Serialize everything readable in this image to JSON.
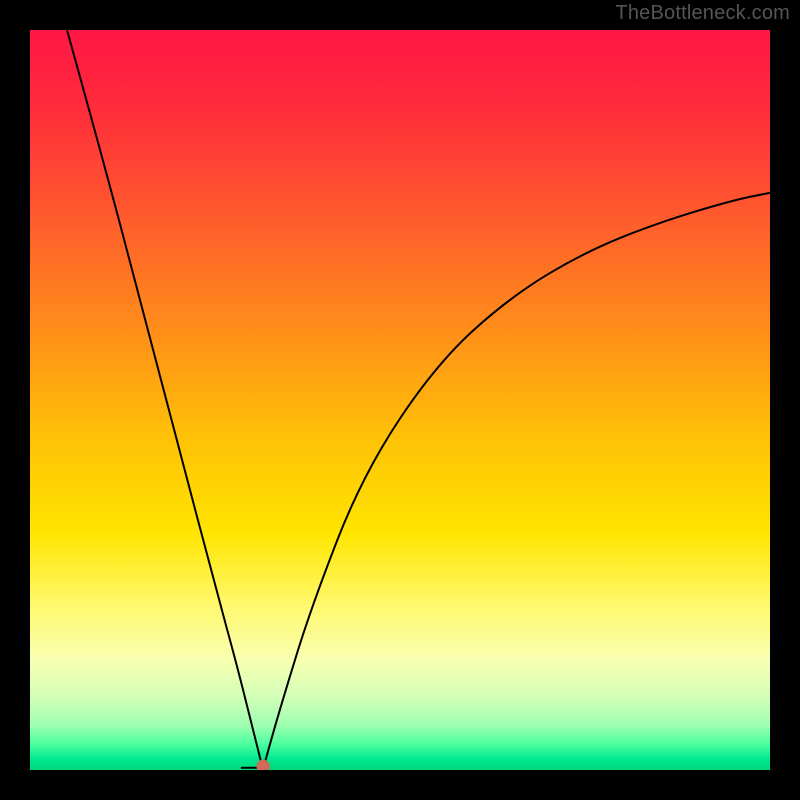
{
  "watermark": "TheBottleneck.com",
  "chart_data": {
    "type": "line",
    "title": "",
    "xlabel": "",
    "ylabel": "",
    "xlim": [
      0,
      100
    ],
    "ylim": [
      0,
      100
    ],
    "background": {
      "type": "vertical-gradient",
      "stops": [
        {
          "pos": 0.0,
          "color": "#ff1744"
        },
        {
          "pos": 0.1,
          "color": "#ff2a3c"
        },
        {
          "pos": 0.25,
          "color": "#ff5a2d"
        },
        {
          "pos": 0.4,
          "color": "#ff8c1a"
        },
        {
          "pos": 0.55,
          "color": "#ffc107"
        },
        {
          "pos": 0.68,
          "color": "#ffe500"
        },
        {
          "pos": 0.78,
          "color": "#fff970"
        },
        {
          "pos": 0.85,
          "color": "#f9ffb0"
        },
        {
          "pos": 0.9,
          "color": "#d4ffb8"
        },
        {
          "pos": 0.94,
          "color": "#9cffb0"
        },
        {
          "pos": 0.965,
          "color": "#4cffa0"
        },
        {
          "pos": 0.985,
          "color": "#00e990"
        },
        {
          "pos": 1.0,
          "color": "#00d77b"
        }
      ]
    },
    "series": [
      {
        "name": "bottleneck-curve",
        "comment": "V-shaped curve dipping to near-zero at x≈31.5; rises steeply toward both sides",
        "x": [
          5,
          10,
          15,
          20,
          25,
          28,
          30,
          31,
          31.5,
          32,
          34,
          38,
          45,
          55,
          65,
          75,
          85,
          95,
          100
        ],
        "y": [
          100,
          82,
          63,
          44,
          25,
          14,
          6,
          2,
          0,
          2,
          9,
          22,
          40,
          55,
          64,
          70,
          74,
          77,
          78
        ]
      }
    ],
    "marker": {
      "x": 31.5,
      "y": 0.5,
      "color": "#d06a5a",
      "radius_pct": 0.9
    },
    "flat_segment": {
      "x0": 28.5,
      "x1": 31.5,
      "y": 0.3
    }
  }
}
